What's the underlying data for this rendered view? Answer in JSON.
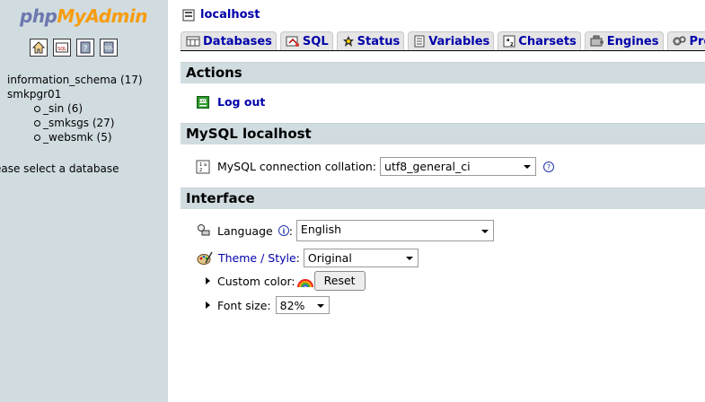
{
  "left": {
    "logo": {
      "part1": "php",
      "part2": "MyAdmin"
    },
    "quicklinks": [
      {
        "name": "home-icon"
      },
      {
        "name": "query-window-icon"
      },
      {
        "name": "documentation-icon"
      },
      {
        "name": "sql-docs-icon"
      }
    ],
    "databases": {
      "top": [
        "information_schema (17)",
        "smkpgr01"
      ],
      "children": [
        "_sin (6)",
        "_smksgs (27)",
        "_websmk (5)"
      ]
    },
    "select_hint": "ease select a database"
  },
  "main": {
    "server": "localhost",
    "tabs": [
      {
        "label": "Databases",
        "icon": "database-icon"
      },
      {
        "label": "SQL",
        "icon": "sql-icon"
      },
      {
        "label": "Status",
        "icon": "status-icon"
      },
      {
        "label": "Variables",
        "icon": "variables-icon"
      },
      {
        "label": "Charsets",
        "icon": "charsets-icon"
      },
      {
        "label": "Engines",
        "icon": "engines-icon"
      },
      {
        "label": "Processes",
        "icon": "processes-icon"
      }
    ],
    "actions": {
      "title": "Actions",
      "logout": "Log out"
    },
    "mysql": {
      "title": "MySQL localhost",
      "collation_label": "MySQL connection collation:",
      "collation_value": "utf8_general_ci"
    },
    "interface": {
      "title": "Interface",
      "language_label": "Language",
      "language_suffix": ":",
      "language_value": "English",
      "theme_label": "Theme / Style",
      "theme_suffix": ":",
      "theme_value": "Original",
      "custom_color_label": "Custom color:",
      "reset_label": "Reset",
      "font_size_label": "Font size:",
      "font_size_value": "82%"
    }
  },
  "colors": {
    "left_bg": "#d0dce0",
    "section_bg": "#d0dce0",
    "link": "#0000aa",
    "logo_php": "#6c78af",
    "logo_myadmin": "#f89c0e"
  }
}
